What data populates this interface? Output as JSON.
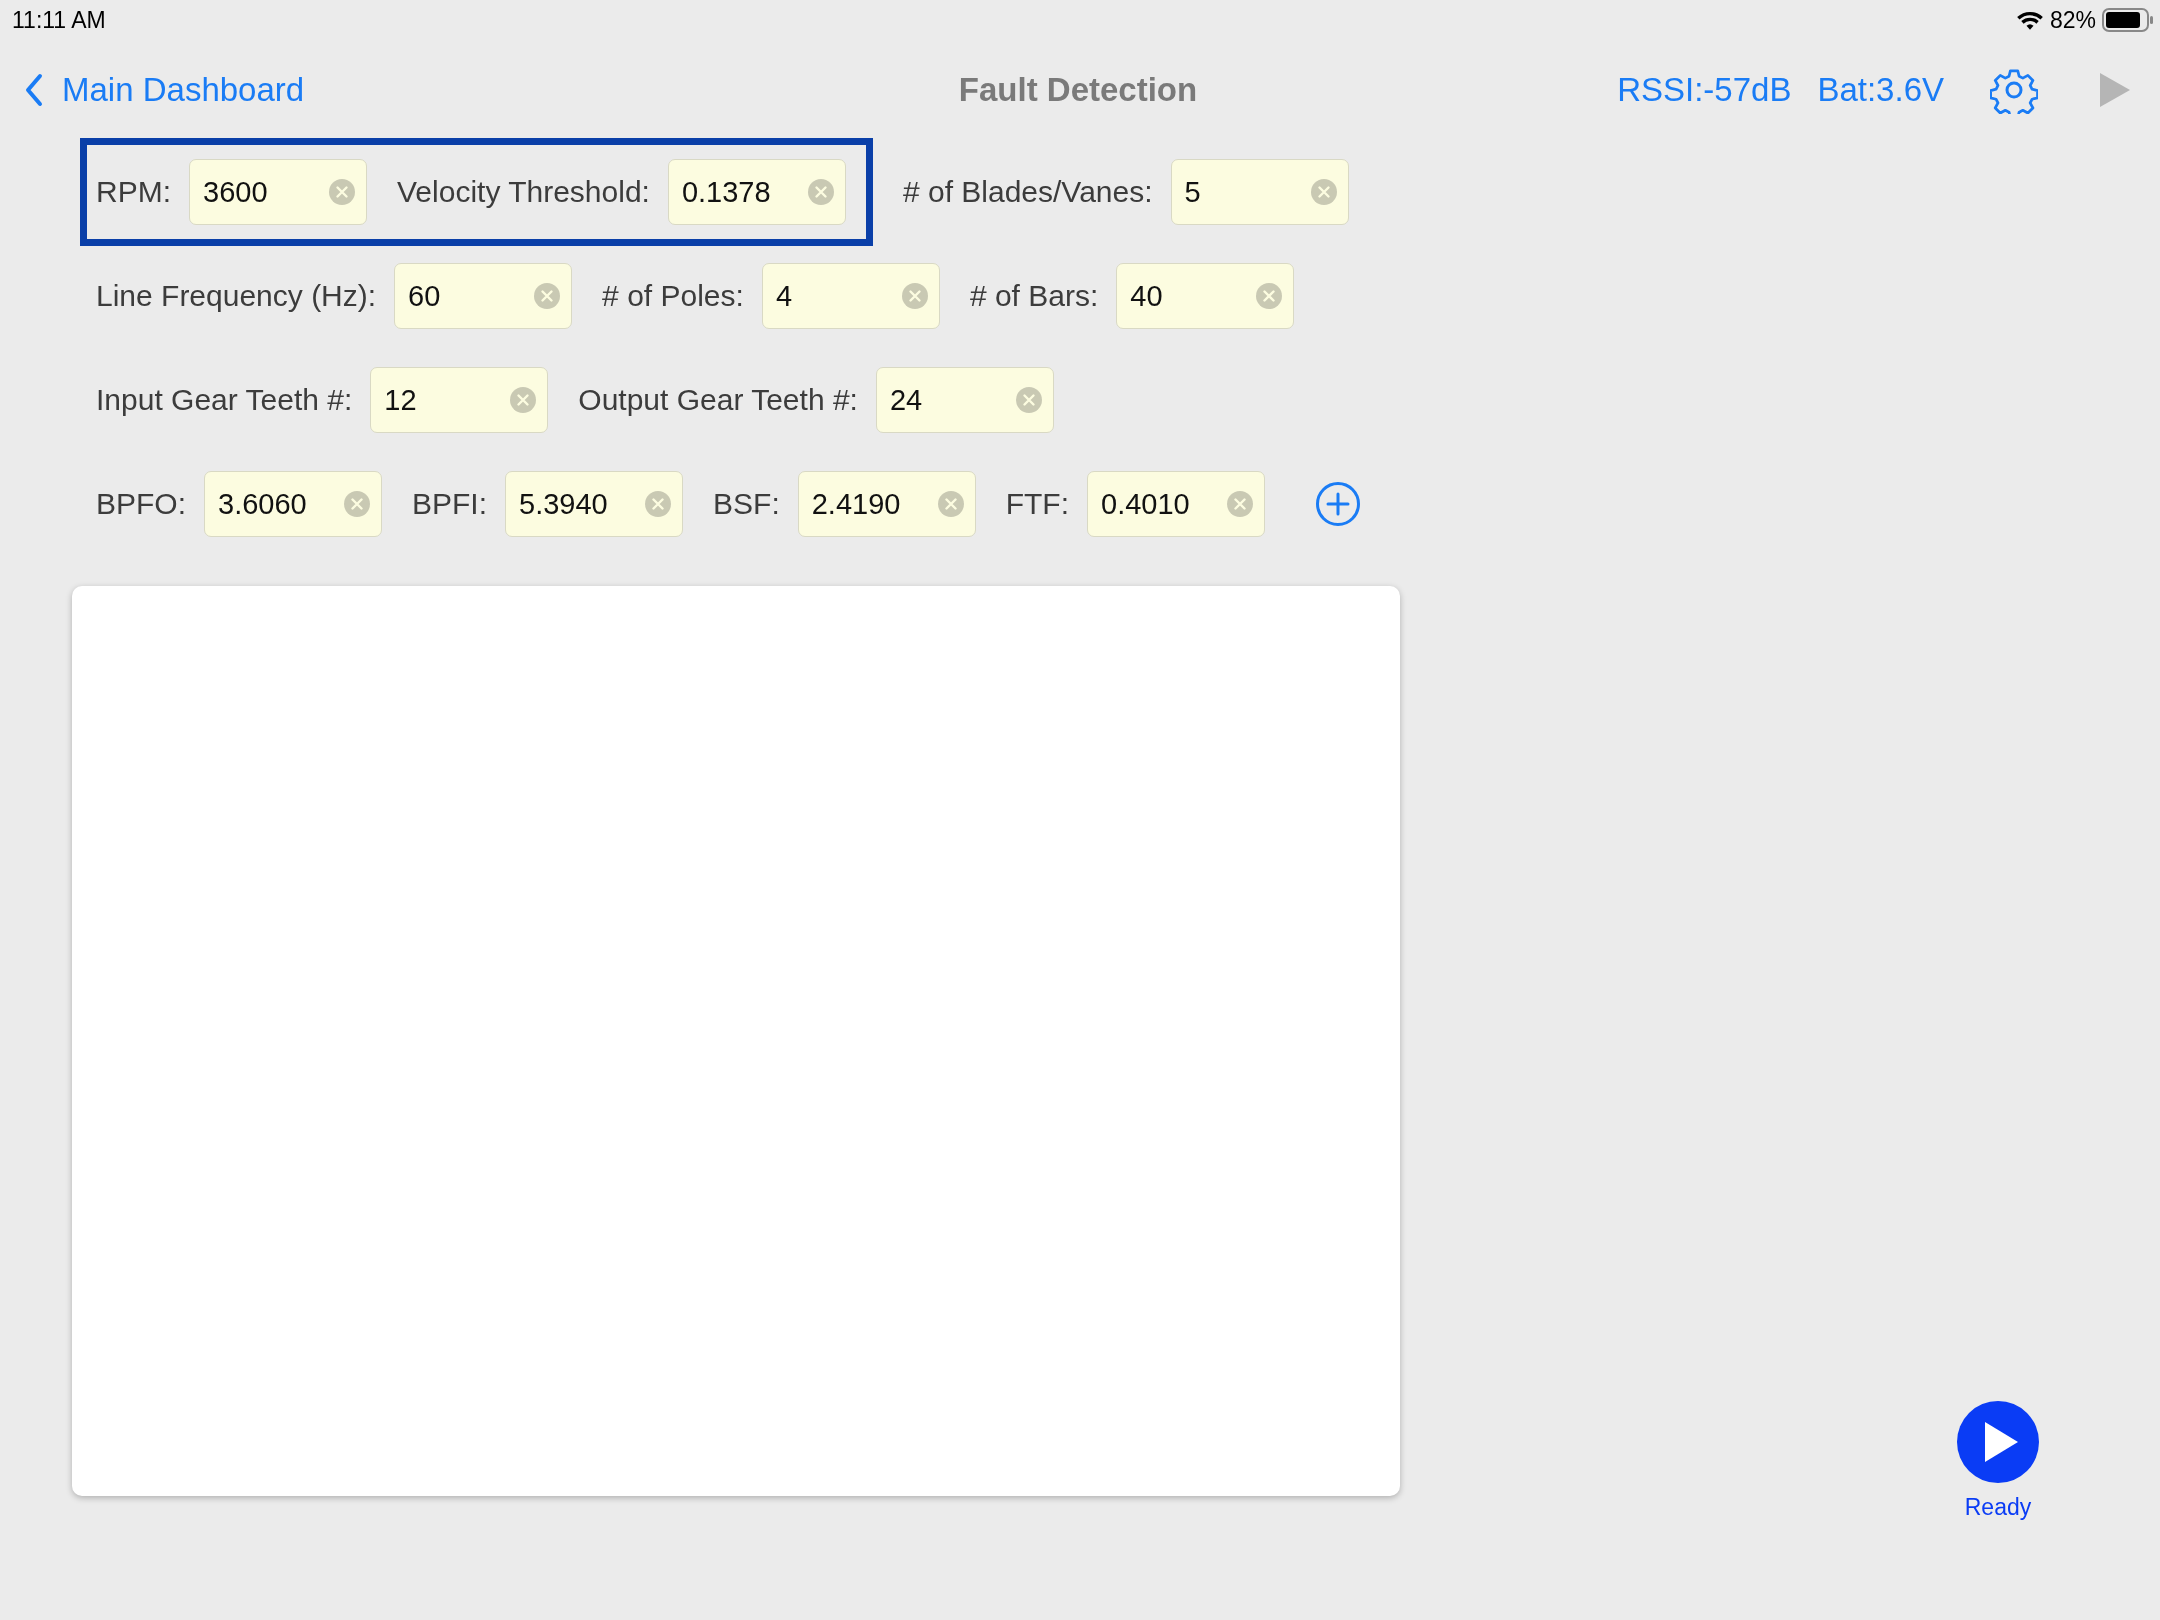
{
  "status_bar": {
    "time": "11:11 AM",
    "battery_percent": "82%"
  },
  "nav": {
    "back_label": "Main Dashboard",
    "title": "Fault Detection",
    "rssi": "RSSI:-57dB",
    "battery": "Bat:3.6V"
  },
  "rows": [
    {
      "items": [
        {
          "kind": "field",
          "label": "RPM:",
          "value": "3600",
          "highlighted": true
        },
        {
          "kind": "field",
          "label": "Velocity Threshold:",
          "value": "0.1378",
          "highlighted": true
        },
        {
          "kind": "field",
          "label": "# of Blades/Vanes:",
          "value": "5",
          "highlighted": false
        }
      ]
    },
    {
      "items": [
        {
          "kind": "field",
          "label": "Line Frequency (Hz):",
          "value": "60",
          "highlighted": false
        },
        {
          "kind": "field",
          "label": "# of Poles:",
          "value": "4",
          "highlighted": false
        },
        {
          "kind": "field",
          "label": "# of Bars:",
          "value": "40",
          "highlighted": false
        }
      ]
    },
    {
      "items": [
        {
          "kind": "field",
          "label": "Input Gear Teeth #:",
          "value": "12",
          "highlighted": false
        },
        {
          "kind": "field",
          "label": "Output Gear Teeth #:",
          "value": "24",
          "highlighted": false
        }
      ]
    },
    {
      "items": [
        {
          "kind": "field",
          "label": "BPFO:",
          "value": "3.6060",
          "highlighted": false
        },
        {
          "kind": "field",
          "label": "BPFI:",
          "value": "5.3940",
          "highlighted": false
        },
        {
          "kind": "field",
          "label": "BSF:",
          "value": "2.4190",
          "highlighted": false
        },
        {
          "kind": "field",
          "label": "FTF:",
          "value": "0.4010",
          "highlighted": false
        },
        {
          "kind": "add"
        }
      ]
    }
  ],
  "run": {
    "label": "Ready"
  }
}
